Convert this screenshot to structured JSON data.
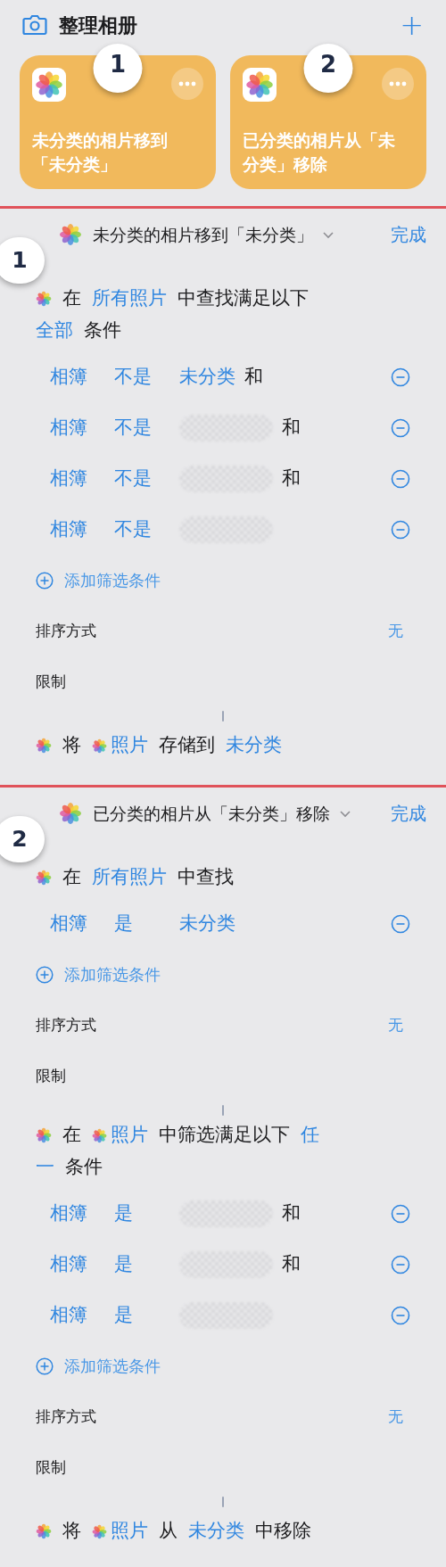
{
  "header": {
    "title": "整理相册",
    "add_button": "+"
  },
  "shortcuts": [
    {
      "badge": "1",
      "title": "未分类的相片移到「未分类」"
    },
    {
      "badge": "2",
      "title": "已分类的相片从「未分类」移除"
    }
  ],
  "editors": [
    {
      "badge": "1",
      "title": "未分类的相片移到「未分类」",
      "done": "完成",
      "blocks": [
        {
          "kind": "find",
          "lines": [
            [
              {
                "kind": "app_icon"
              },
              {
                "kind": "text",
                "text": "在"
              },
              {
                "kind": "param",
                "text": "所有照片"
              },
              {
                "kind": "text",
                "text": "中查找满足以下"
              }
            ],
            [
              {
                "kind": "param",
                "text": "全部"
              },
              {
                "kind": "text",
                "text": "条件"
              }
            ]
          ],
          "conditions": [
            {
              "field": "相簿",
              "op": "不是",
              "value": "未分类",
              "joiner": "和"
            },
            {
              "field": "相簿",
              "op": "不是",
              "joiner": "和"
            },
            {
              "field": "相簿",
              "op": "不是",
              "joiner": "和"
            },
            {
              "field": "相簿",
              "op": "不是"
            }
          ],
          "add_filter": "添加筛选条件",
          "sort_label": "排序方式",
          "sort_value": "无",
          "limit_label": "限制"
        },
        {
          "kind": "action",
          "lines": [
            [
              {
                "kind": "app_icon"
              },
              {
                "kind": "text",
                "text": "将"
              },
              {
                "kind": "param",
                "text": "照片",
                "icon": true
              },
              {
                "kind": "text",
                "text": "存储到"
              },
              {
                "kind": "param",
                "text": "未分类"
              }
            ]
          ]
        }
      ]
    },
    {
      "badge": "2",
      "title": "已分类的相片从「未分类」移除",
      "done": "完成",
      "blocks": [
        {
          "kind": "find",
          "lines": [
            [
              {
                "kind": "app_icon"
              },
              {
                "kind": "text",
                "text": "在"
              },
              {
                "kind": "param",
                "text": "所有照片"
              },
              {
                "kind": "text",
                "text": "中查找"
              }
            ]
          ],
          "conditions": [
            {
              "field": "相簿",
              "op": "是",
              "value": "未分类"
            }
          ],
          "add_filter": "添加筛选条件",
          "sort_label": "排序方式",
          "sort_value": "无",
          "limit_label": "限制"
        },
        {
          "kind": "find",
          "lines": [
            [
              {
                "kind": "app_icon"
              },
              {
                "kind": "text",
                "text": "在"
              },
              {
                "kind": "param",
                "text": "照片",
                "icon": true
              },
              {
                "kind": "text",
                "text": "中筛选满足以下"
              },
              {
                "kind": "param",
                "text": "任"
              }
            ],
            [
              {
                "kind": "param",
                "text": "一"
              },
              {
                "kind": "text",
                "text": "条件"
              }
            ]
          ],
          "conditions": [
            {
              "field": "相簿",
              "op": "是",
              "joiner": "和"
            },
            {
              "field": "相簿",
              "op": "是",
              "joiner": "和"
            },
            {
              "field": "相簿",
              "op": "是"
            }
          ],
          "add_filter": "添加筛选条件",
          "sort_label": "排序方式",
          "sort_value": "无",
          "limit_label": "限制"
        },
        {
          "kind": "action",
          "lines": [
            [
              {
                "kind": "app_icon"
              },
              {
                "kind": "text",
                "text": "将"
              },
              {
                "kind": "param",
                "text": "照片",
                "icon": true
              },
              {
                "kind": "text",
                "text": "从"
              },
              {
                "kind": "param",
                "text": "未分类"
              },
              {
                "kind": "text",
                "text": "中移除"
              }
            ]
          ]
        }
      ]
    }
  ]
}
